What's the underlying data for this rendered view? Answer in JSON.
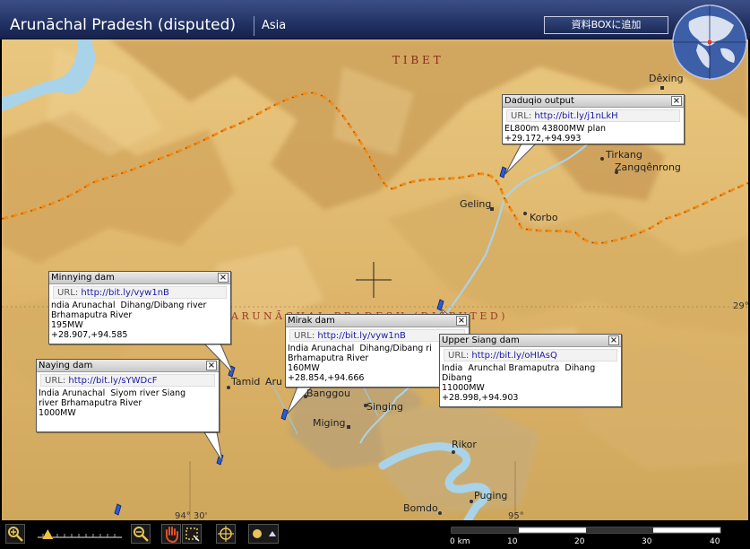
{
  "header": {
    "title": "Arunāchal Pradesh (disputed)",
    "region": "Asia",
    "add_box_button": "資料BOXに追加"
  },
  "map": {
    "region_labels": {
      "tibet": "T I B E T",
      "arunachal": "A R U N Ā C H A L   P R A D E S H   ( D I S P U T E D )"
    },
    "places": [
      "Dêxing",
      "Tirkang",
      "Zangqênrong",
      "Geling",
      "Korbo",
      "Tamid",
      "Aru",
      "Banggou",
      "Singing",
      "Miging",
      "Rikor",
      "Puging",
      "Bomdo"
    ],
    "coordinates": [
      "29°",
      "94° 30'",
      "95°"
    ],
    "border_color": "#f08c1c",
    "river_color": "#a9d3e8"
  },
  "popups": [
    {
      "title": "Daduqio output",
      "url_label": "URL:",
      "url": "http://bit.ly/j1nLkH",
      "body": "EL800m 43800MW plan\n+29.172,+94.993"
    },
    {
      "title": "Minnying  dam",
      "url_label": "URL:",
      "url": "http://bit.ly/vyw1nB",
      "body": "ndia Arunachal  Dihang/Dibang river\nBrhamaputra River\n195MW\n+28.907,+94.585"
    },
    {
      "title": "Mirak dam",
      "url_label": "URL:",
      "url": "http://bit.ly/vyw1nB",
      "body": "India Arunachal  Dihang/Dibang ri\nBrhamaputra River\n160MW\n+28.854,+94.666"
    },
    {
      "title": "Upper Siang dam",
      "url_label": "URL:",
      "url": "http://bit.ly/oHIAsQ",
      "body": "India  Arunchal Bramaputra  Dihang\nDibang\n11000MW\n+28.998,+94.903"
    },
    {
      "title": "Naying dam",
      "url_label": "URL:",
      "url": "http://bit.ly/sYWDcF",
      "body": "India Arunachal  Siyom river Siang\nriver Brhamaputra River\n1000MW"
    }
  ],
  "toolbar": {
    "scale_labels": [
      "0 km",
      "10",
      "20",
      "30",
      "40"
    ],
    "zoom_level": 0.12
  }
}
